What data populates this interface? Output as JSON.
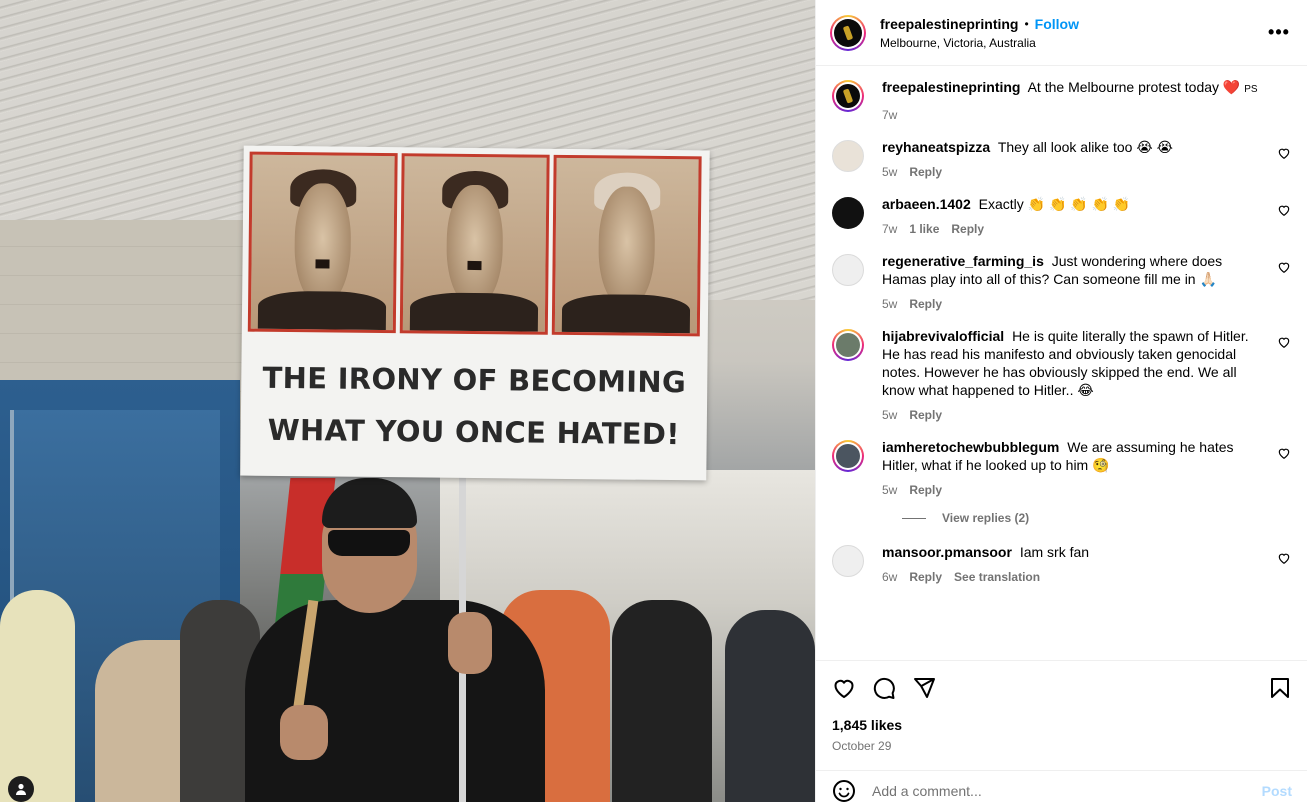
{
  "post": {
    "username": "freepalestineprinting",
    "follow_label": "Follow",
    "location": "Melbourne, Victoria, Australia",
    "more_label": "•••",
    "sign_line1": "THE IRONY OF BECOMING",
    "sign_line2": "WHAT YOU ONCE HATED!"
  },
  "caption": {
    "username": "freepalestineprinting",
    "text": "At the Melbourne protest today ❤️",
    "suffix": "PS",
    "time": "7w"
  },
  "comments": [
    {
      "username": "reyhaneatspizza",
      "text": "They all look alike too 😭 😭",
      "time": "5w",
      "likes": "",
      "reply": "Reply",
      "extra": ""
    },
    {
      "username": "arbaeen.1402",
      "text": "Exactly 👏 👏 👏 👏 👏",
      "time": "7w",
      "likes": "1 like",
      "reply": "Reply",
      "extra": ""
    },
    {
      "username": "regenerative_farming_is",
      "text": "Just wondering where does Hamas play into all of this? Can someone fill me in 🙏🏻",
      "time": "5w",
      "likes": "",
      "reply": "Reply",
      "extra": ""
    },
    {
      "username": "hijabrevivalofficial",
      "text": "He is quite literally the spawn of Hitler. He has read his manifesto and obviously taken genocidal notes. However he has obviously skipped the end. We all know what happened to Hitler.. 😂",
      "time": "5w",
      "likes": "",
      "reply": "Reply",
      "extra": ""
    },
    {
      "username": "iamheretochewbubblegum",
      "text": "We are assuming he hates Hitler, what if he looked up to him 🧐",
      "time": "5w",
      "likes": "",
      "reply": "Reply",
      "extra": ""
    },
    {
      "username": "mansoor.pmansoor",
      "text": "Iam srk fan",
      "time": "6w",
      "likes": "",
      "reply": "Reply",
      "extra": "See translation"
    }
  ],
  "view_replies": "View replies (2)",
  "likes": "1,845 likes",
  "date": "October 29",
  "add_comment_placeholder": "Add a comment...",
  "post_button": "Post",
  "icons": {
    "like": "heart-icon",
    "comment": "comment-icon",
    "share": "share-icon",
    "save": "bookmark-icon",
    "emoji": "emoji-icon",
    "more": "more-icon"
  },
  "colors": {
    "follow": "#0095f6",
    "meta": "#737373",
    "post_disabled": "#b3dbff"
  }
}
